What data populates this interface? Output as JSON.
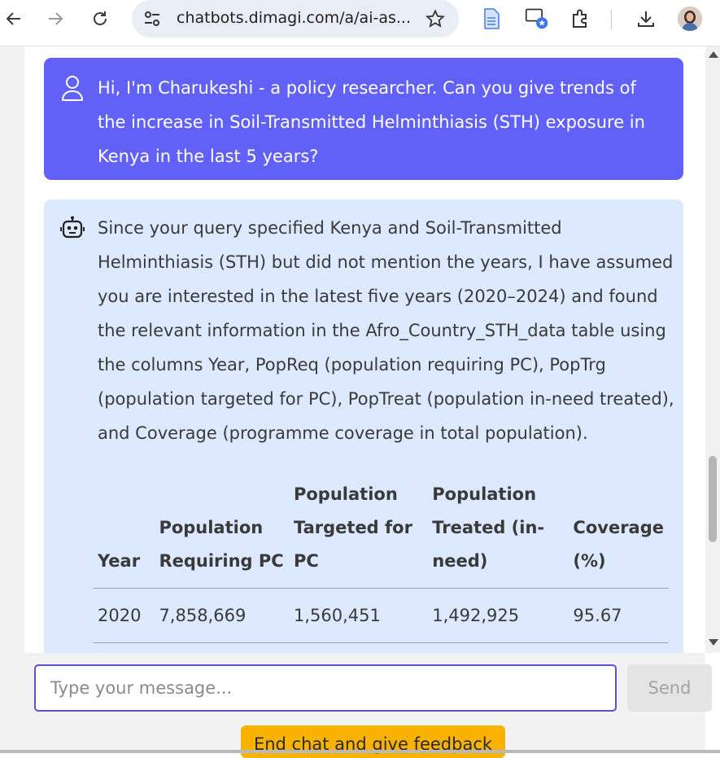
{
  "browser": {
    "url": "chatbots.dimagi.com/a/ai-as...",
    "icons": [
      "back-icon",
      "forward-icon",
      "reload-icon",
      "site-settings-icon",
      "bookmark-star-icon",
      "document-icon",
      "cast-icon",
      "extensions-icon",
      "download-icon",
      "profile-avatar"
    ]
  },
  "chat": {
    "user_message": "Hi, I'm Charukeshi - a policy researcher. Can you give trends of the increase in Soil-Transmitted Helminthiasis (STH) exposure in Kenya in the last 5 years?",
    "bot_message": "Since your query specified Kenya and Soil-Transmitted Helminthiasis (STH) but did not mention the years, I have assumed you are interested in the latest five years (2020–2024) and found the relevant information in the Afro_Country_STH_data table using the columns Year, PopReq (population requiring PC), PopTrg (population targeted for PC), PopTreat (population in-need treated), and Coverage (programme coverage in total population).",
    "table": {
      "headers": [
        "Year",
        "Population Requiring PC",
        "Population Targeted for PC",
        "Population Treated (in-need)",
        "Coverage (%)"
      ],
      "rows": [
        [
          "2020",
          "7,858,669",
          "1,560,451",
          "1,492,925",
          "95.67"
        ]
      ]
    }
  },
  "composer": {
    "placeholder": "Type your message...",
    "send_label": "Send",
    "feedback_label": "End chat and give feedback"
  },
  "colors": {
    "user_bubble": "#6161f8",
    "bot_bubble": "#dce9fe",
    "feedback_button": "#f9b200",
    "input_border": "#5c52d0"
  }
}
